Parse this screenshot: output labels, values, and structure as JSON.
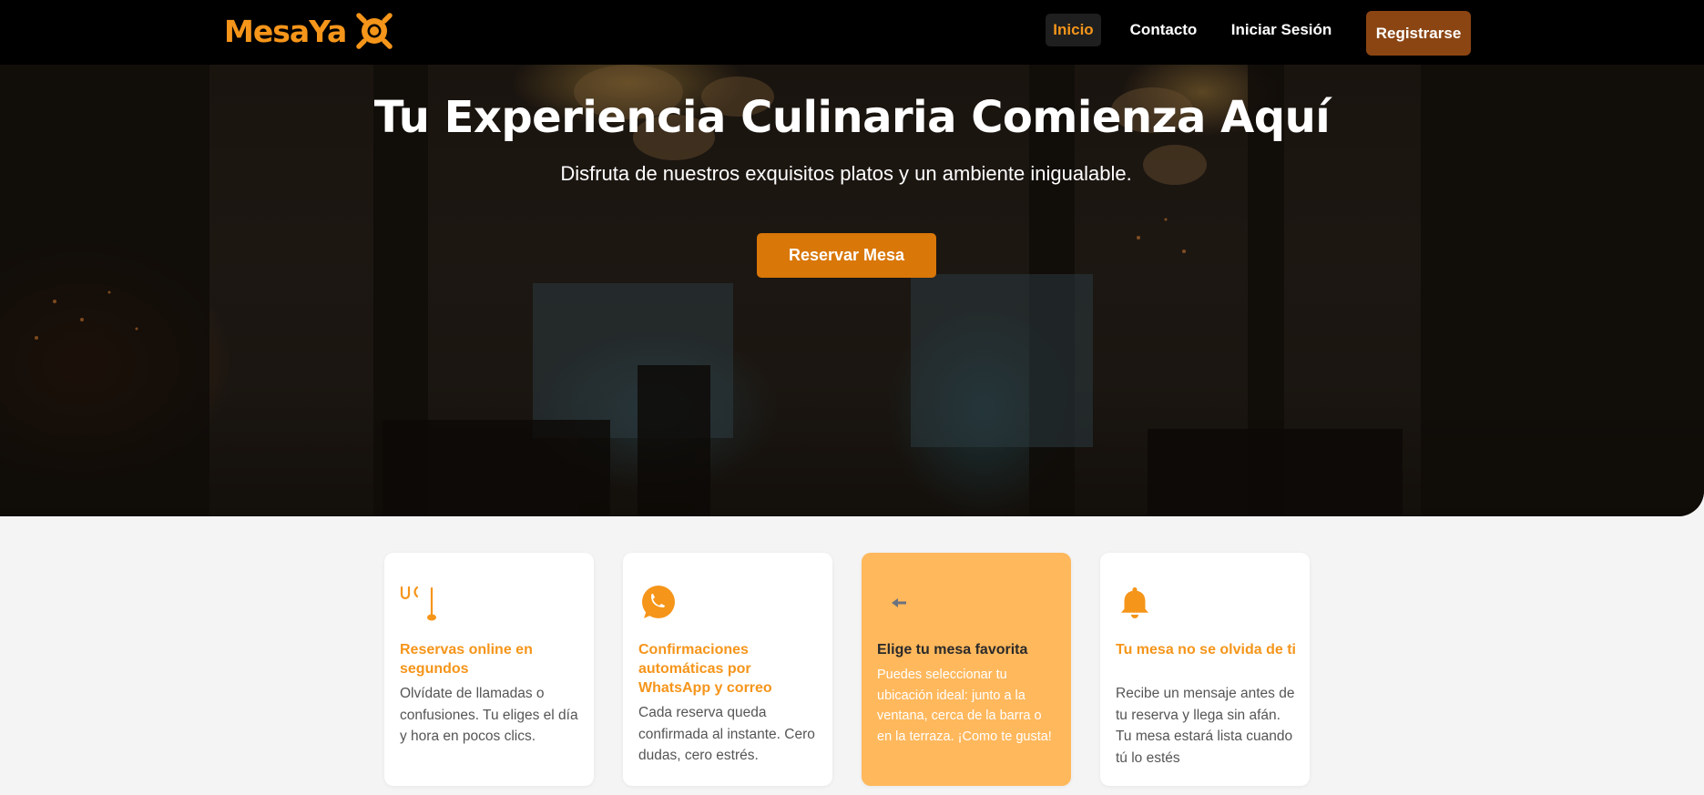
{
  "brand": {
    "name": "MesaYa",
    "accent": "#f5951a",
    "dark_accent": "#8b4513"
  },
  "nav": {
    "items": [
      {
        "label": "Inicio",
        "active": true
      },
      {
        "label": "Contacto"
      },
      {
        "label": "Iniciar Sesión"
      }
    ],
    "register_label": "Registrarse"
  },
  "hero": {
    "title": "Tu Experiencia Culinaria Comienza Aquí",
    "subtitle": "Disfruta de nuestros exquisitos platos y un ambiente inigualable.",
    "cta_label": "Reservar Mesa"
  },
  "features": [
    {
      "icon": "utensils-icon",
      "title": "Reservas online en segundos",
      "text": "Olvídate de llamadas o confusiones. Tu eliges el día y hora en pocos clics."
    },
    {
      "icon": "whatsapp-icon",
      "title": "Confirmaciones automáticas por WhatsApp y correo",
      "text": "Cada reserva queda confirmada al instante. Cero dudas, cero estrés."
    },
    {
      "icon": "arrow-left-icon",
      "title": "Elige tu mesa favorita",
      "text": "Puedes seleccionar tu ubicación ideal: junto a la ventana, cerca de la barra o en la terraza. ¡Como te gusta!",
      "highlight": true
    },
    {
      "icon": "bell-icon",
      "title": "Tu mesa no se olvida de ti",
      "text": "Recibe un mensaje antes de tu reserva y llega sin afán. Tu mesa estará lista cuando tú lo estés"
    }
  ]
}
